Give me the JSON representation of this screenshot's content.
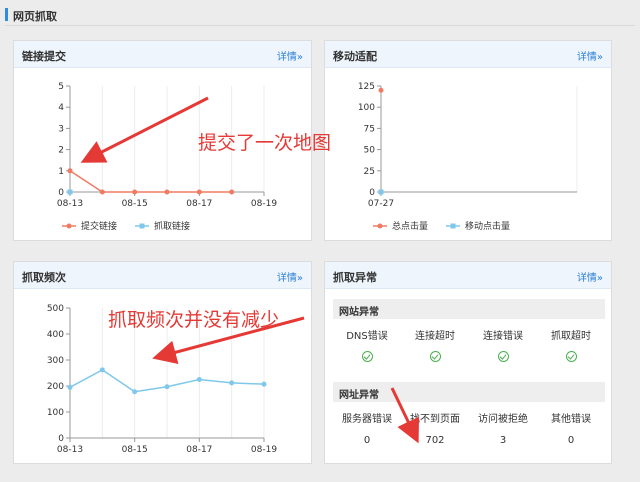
{
  "page": {
    "title": "网页抓取"
  },
  "more_label": "详情»",
  "colors": {
    "submit": "#f07a63",
    "crawl": "#7fc8ec",
    "accent": "#2b8de3",
    "annot": "#e53935",
    "ok": "#4caf50"
  },
  "panels": {
    "link_submit": {
      "title": "链接提交"
    },
    "mobile": {
      "title": "移动适配"
    },
    "crawl_freq": {
      "title": "抓取频次"
    },
    "crawl_error": {
      "title": "抓取异常"
    }
  },
  "chart_data": [
    {
      "type": "line",
      "panel": "链接提交",
      "x": [
        "08-13",
        "08-14",
        "08-15",
        "08-16",
        "08-17",
        "08-18"
      ],
      "xticks": [
        "08-13",
        "08-15",
        "08-17",
        "08-19"
      ],
      "ylim": [
        0,
        5
      ],
      "yticks": [
        0,
        1,
        2,
        3,
        4,
        5
      ],
      "series": [
        {
          "name": "提交链接",
          "values": [
            1,
            0,
            0,
            0,
            0,
            0
          ]
        },
        {
          "name": "抓取链接",
          "values": [
            0
          ]
        }
      ],
      "legend": "bottom"
    },
    {
      "type": "line",
      "panel": "移动适配",
      "x": [
        "07-27"
      ],
      "xticks": [
        "07-27"
      ],
      "ylim": [
        0,
        125
      ],
      "yticks": [
        0,
        25,
        50,
        75,
        100,
        125
      ],
      "series": [
        {
          "name": "总点击量",
          "values": [
            120
          ]
        },
        {
          "name": "移动点击量",
          "values": [
            0
          ]
        }
      ],
      "legend": "bottom"
    },
    {
      "type": "line",
      "panel": "抓取频次",
      "x": [
        "08-13",
        "08-14",
        "08-15",
        "08-16",
        "08-17",
        "08-18",
        "08-19"
      ],
      "xticks": [
        "08-13",
        "08-15",
        "08-17",
        "08-19"
      ],
      "ylim": [
        0,
        500
      ],
      "yticks": [
        0,
        100,
        200,
        300,
        400,
        500
      ],
      "series": [
        {
          "values": [
            195,
            262,
            178,
            197,
            225,
            212,
            207
          ]
        }
      ]
    }
  ],
  "crawl_error": {
    "site": {
      "title": "网站异常",
      "headers": [
        "DNS错误",
        "连接超时",
        "连接错误",
        "抓取超时"
      ],
      "status_icon": "check-circle-icon"
    },
    "url": {
      "title": "网址异常",
      "headers": [
        "服务器错误",
        "找不到页面",
        "访问被拒绝",
        "其他错误"
      ],
      "values": [
        "0",
        "702",
        "3",
        "0"
      ]
    }
  },
  "annotations": {
    "submit": "提交了一次地图",
    "freq": "抓取频次并没有减少"
  }
}
